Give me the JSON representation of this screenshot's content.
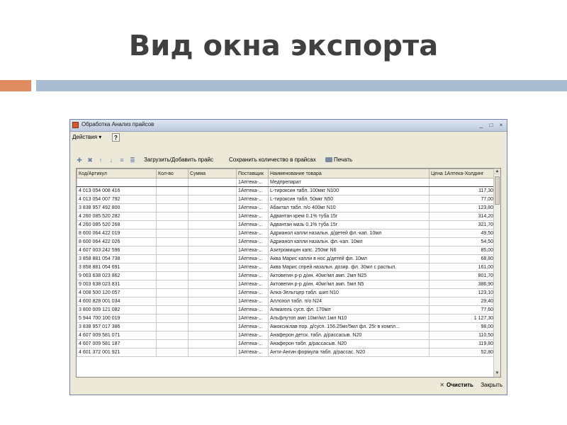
{
  "slide": {
    "title": "Вид окна экспорта"
  },
  "window": {
    "title": "Обработка  Анализ прайсов",
    "controls": [
      "_",
      "□",
      "×"
    ]
  },
  "menu": {
    "actions": "Действия ▾",
    "help": "?"
  },
  "toolbar": {
    "load_button": "Загрузить/Добавить прайс",
    "save_button": "Сохранить количество в прайсах",
    "print_button": "Печать"
  },
  "grid": {
    "columns": [
      "Код/Артикул",
      "Кол-во",
      "Сумма",
      "Поставщик",
      "Наименование товара",
      "Цена 1Аптека-Холдинг"
    ],
    "rows": [
      [
        "",
        "",
        "",
        "1Аптека-...",
        "Медпрепарат",
        ""
      ],
      [
        "4 013 054 008 416",
        "",
        "",
        "1Аптека-...",
        "L-тироксин табл. 100мкг N100",
        "117,30"
      ],
      [
        "4 013 054 007 792",
        "",
        "",
        "1Аптека-...",
        "L-тироксин табл. 50мкг N50",
        "77,00"
      ],
      [
        "3 838 957 492 800",
        "",
        "",
        "1Аптека-...",
        "Абактал табл. п/о 400мг N10",
        "123,80"
      ],
      [
        "4 260 085 520 282",
        "",
        "",
        "1Аптека-...",
        "Адвантан крем 0.1% туба 15г",
        "314,20"
      ],
      [
        "4 260 085 520 268",
        "",
        "",
        "1Аптека-...",
        "Адвантан мазь 0.1% туба 15г",
        "321,70"
      ],
      [
        "8 600 064 422 019",
        "",
        "",
        "1Аптека-...",
        "Адрианол капли назальн. д/детей фл.-кап. 10мл",
        "49,50"
      ],
      [
        "8 600 064 422 026",
        "",
        "",
        "1Аптека-...",
        "Адрианол капли назальн. фл.-кап. 10мл",
        "54,50"
      ],
      [
        "4 607 003 242 596",
        "",
        "",
        "1Аптека-...",
        "Азитромицин капс. 250мг N6",
        "85,00"
      ],
      [
        "3 858 881 054 738",
        "",
        "",
        "1Аптека-...",
        "Аква Марис капли в нос д/детей фл. 10мл",
        "68,80"
      ],
      [
        "3 858 881 054 691",
        "",
        "",
        "1Аптека-...",
        "Аква Марис спрей назальн. дозир. фл. 30мл с распыл.",
        "161,00"
      ],
      [
        "9 003 638 023 862",
        "",
        "",
        "1Аптека-...",
        "Актовегин р-р д/ин. 40мг/мл амп. 2мл N25",
        "801,70"
      ],
      [
        "9 003 638 023 831",
        "",
        "",
        "1Аптека-...",
        "Актовегин р-р д/ин. 40мг/мл амп. 5мл N5",
        "386,90"
      ],
      [
        "4 008 500 120 057",
        "",
        "",
        "1Аптека-...",
        "Алка-Зельтцер табл. шип N10",
        "123,10"
      ],
      [
        "4 600 828 001 034",
        "",
        "",
        "1Аптека-...",
        "Аллохол табл. п/о N24",
        "29,40"
      ],
      [
        "3 800 009 121 082",
        "",
        "",
        "1Аптека-...",
        "Алмагель сусп. фл. 170мл",
        "77,60"
      ],
      [
        "5 944 700 100 019",
        "",
        "",
        "1Аптека-...",
        "Альфлутоп амп 10мг/мл 1мл N10",
        "1 127,30"
      ],
      [
        "3 838 957 017 386",
        "",
        "",
        "1Аптека-...",
        "Амоксиклав пор. д/сусп. 156.25мг/5мл фл. 25г в компл...",
        "98,00"
      ],
      [
        "4 607 009 581 071",
        "",
        "",
        "1Аптека-...",
        "Анаферон детск. табл. д/рассасыв. N20",
        "110,50"
      ],
      [
        "4 607 009 581 187",
        "",
        "",
        "1Аптека-...",
        "Анаферон табл. д/рассасыв. N20",
        "119,80"
      ],
      [
        "4 601 372 001 921",
        "",
        "",
        "1Аптека-...",
        "Анти-Ангин формула табл. д/рассас. N20",
        "52,80"
      ]
    ]
  },
  "footer": {
    "clear_button": "Очистить",
    "close_button": "Закрыть"
  }
}
